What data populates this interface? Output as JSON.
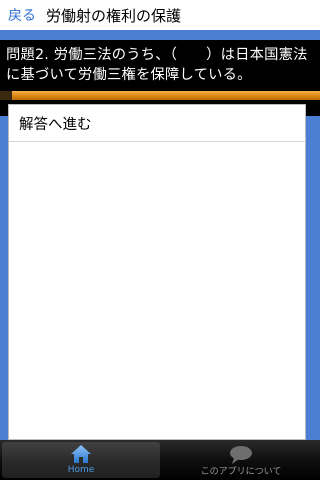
{
  "header": {
    "back_label": "戻る",
    "title": "労働射の権利の保護"
  },
  "question": {
    "text": "問題2. 労働三法のうち、（　　）は日本国憲法に基づいて労働三権を保障している。"
  },
  "panel": {
    "rows": [
      {
        "label": "解答へ進む"
      }
    ]
  },
  "tabbar": {
    "tabs": [
      {
        "label": "Home",
        "icon": "home-icon",
        "active": true
      },
      {
        "label": "このアプリについて",
        "icon": "speech-bubble-icon",
        "active": false
      }
    ]
  },
  "colors": {
    "accent": "#2f6fd6",
    "background_blue": "#4a7fd4",
    "progress_orange": "#e08a14",
    "tab_active": "#4a9be8"
  }
}
